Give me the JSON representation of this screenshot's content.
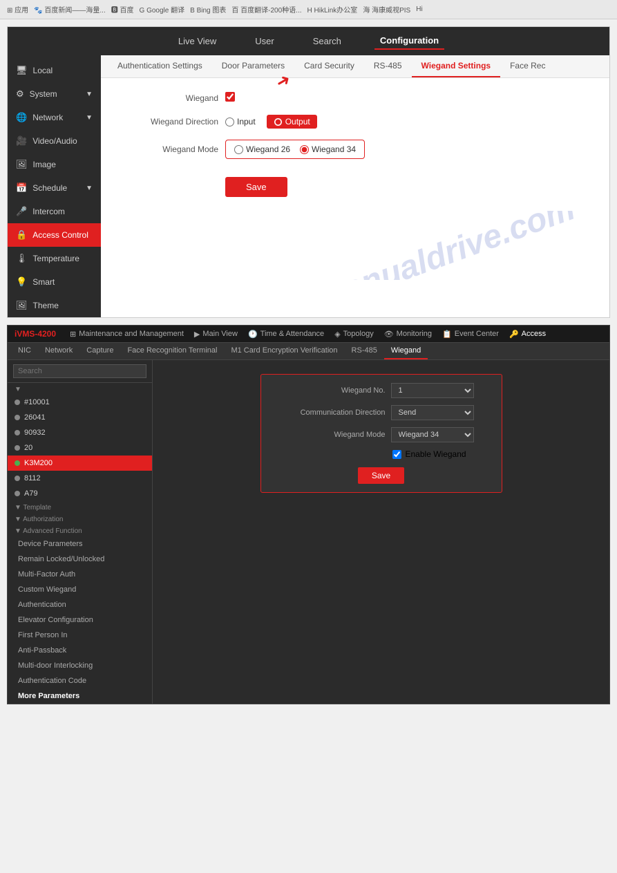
{
  "browser": {
    "bookmarks": [
      "应用",
      "百度新闻——海量...",
      "百度",
      "Google 翻译",
      "Bing 图表",
      "百度翻译-200种语...",
      "HikLink办公室",
      "海康威视PIS",
      "Hi"
    ]
  },
  "screenshot1": {
    "nav": {
      "items": [
        "Live View",
        "User",
        "Search",
        "Configuration"
      ],
      "active": "Configuration"
    },
    "tabs": {
      "items": [
        "Authentication Settings",
        "Door Parameters",
        "Card Security",
        "RS-485",
        "Wiegand Settings",
        "Face Rec"
      ],
      "active": "Wiegand Settings"
    },
    "sidebar": {
      "items": [
        {
          "label": "Local",
          "icon": "🖥",
          "hasArrow": false
        },
        {
          "label": "System",
          "icon": "⚙",
          "hasArrow": true
        },
        {
          "label": "Network",
          "icon": "🌐",
          "hasArrow": true
        },
        {
          "label": "Video/Audio",
          "icon": "🎥",
          "hasArrow": false
        },
        {
          "label": "Image",
          "icon": "🖼",
          "hasArrow": false
        },
        {
          "label": "Schedule",
          "icon": "📅",
          "hasArrow": true
        },
        {
          "label": "Intercom",
          "icon": "🎤",
          "hasArrow": false
        },
        {
          "label": "Access Control",
          "icon": "🔒",
          "hasArrow": false,
          "active": true
        },
        {
          "label": "Temperature",
          "icon": "🌡",
          "hasArrow": false
        },
        {
          "label": "Smart",
          "icon": "💡",
          "hasArrow": false
        },
        {
          "label": "Theme",
          "icon": "🖼",
          "hasArrow": false
        }
      ]
    },
    "form": {
      "wiegand_label": "Wiegand",
      "direction_label": "Wiegand Direction",
      "direction_options": [
        "Input",
        "Output"
      ],
      "direction_selected": "Output",
      "mode_label": "Wiegand Mode",
      "mode_options": [
        "Wiegand 26",
        "Wiegand 34"
      ],
      "mode_selected": "Wiegand 34",
      "save_button": "Save"
    }
  },
  "screenshot2": {
    "header": {
      "logo": "iVMS-4200",
      "nav_items": [
        "Maintenance and Management",
        "Main View",
        "Time & Attendance",
        "Topology",
        "Monitoring",
        "Event Center",
        "Access"
      ]
    },
    "tabs": [
      "NIC",
      "Network",
      "Capture",
      "Face Recognition Terminal",
      "M1 Card Encryption Verification",
      "RS-485",
      "Wiegand"
    ],
    "active_tab": "Wiegand",
    "sidebar": {
      "search_placeholder": "Search",
      "sections": [
        {
          "label": "Template",
          "items": []
        },
        {
          "label": "Authorization",
          "items": []
        },
        {
          "label": "Advanced Function",
          "items": [
            "Device Parameters",
            "Remain Locked/Unlocked",
            "Multi-Factor Auth",
            "Custom Wiegand",
            "Authentication",
            "Elevator Configuration",
            "First Person In",
            "Anti-Passback",
            "Multi-door Interlocking",
            "Authentication Code",
            "More Parameters"
          ]
        }
      ],
      "devices": [
        "#10001",
        "26041",
        "90932",
        "20",
        "K3M200",
        "8112",
        "A79"
      ],
      "selected_device": "K3M200"
    },
    "form": {
      "wiegand_no_label": "Wiegand No.",
      "wiegand_no_value": "1",
      "comm_dir_label": "Communication Direction",
      "comm_dir_value": "Send",
      "wiegand_mode_label": "Wiegand Mode",
      "wiegand_mode_value": "Wiegand 34",
      "enable_label": "Enable Wiegand",
      "save_button": "Save"
    }
  }
}
